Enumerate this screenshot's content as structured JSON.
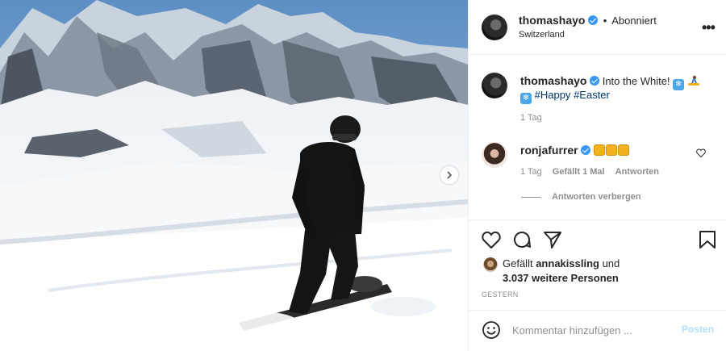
{
  "post": {
    "username": "thomashayo",
    "follow_sep": "•",
    "follow_status": "Abonniert",
    "location": "Switzerland",
    "more": "•••",
    "image_alt": "Snowboarder on a snowy mountain slope",
    "next_icon": "chevron-right-icon"
  },
  "caption": {
    "username": "thomashayo",
    "text": "Into the White!",
    "hashtag_happy": "#Happy",
    "hashtag_easter": "#Easter",
    "time": "1 Tag"
  },
  "comment": {
    "username": "ronjafurrer",
    "time": "1 Tag",
    "likes": "Gefällt 1 Mal",
    "reply": "Antworten",
    "hide_replies": "Antworten verbergen"
  },
  "likes": {
    "prefix": "Gefällt",
    "user": "annakissling",
    "and": "und",
    "others": "3.037 weitere Personen"
  },
  "date": "GESTERN",
  "composer": {
    "placeholder": "Kommentar hinzufügen ...",
    "post_label": "Posten"
  },
  "colors": {
    "verified": "#3897f0",
    "hashtag": "#003569",
    "post_disabled": "#b2dffc",
    "muted": "#8e8e8e"
  }
}
